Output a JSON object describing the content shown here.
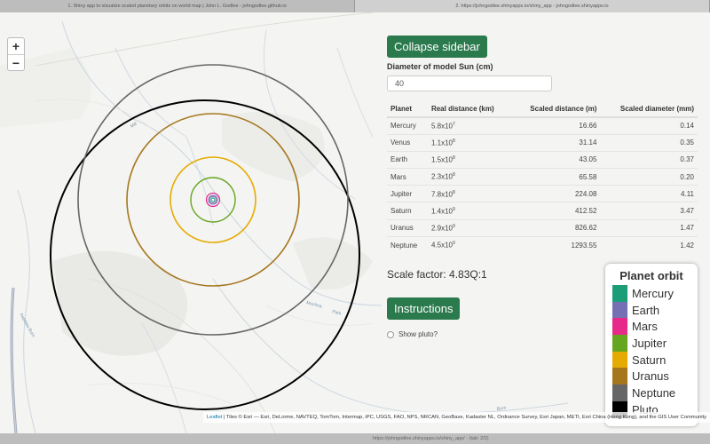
{
  "browser": {
    "tabs": [
      {
        "title": "1. Shiny app to visualize scaled planetary orbits on world map | John L. Godlee - johngodlee.github.io",
        "active": false
      },
      {
        "title": "2. https://johngodlee.shinyapps.io/shiny_app - johngodlee.shinyapps.io",
        "active": true
      }
    ],
    "status": "https://johngodlee.shinyapps.io/shiny_app/ - (tab: 2/2)"
  },
  "map": {
    "zoom_in": "+",
    "zoom_out": "−",
    "place_labels": [
      "Mill",
      "Burn",
      "Peebles",
      "Bantry",
      "Mochna",
      "Park",
      "Pebbles Burn"
    ],
    "attribution_link": "Leaflet",
    "attribution_text": " | Tiles © Esri — Esri, DeLorme, NAVTEQ, TomTom, Intermap, iPC, USGS, FAO, NPS, NRCAN, GeoBase, Kadaster NL, Ordnance Survey, Esri Japan, METI, Esri China (Hong Kong), and the GIS User Community"
  },
  "sidebar": {
    "collapse_label": "Collapse sidebar",
    "diameter_label": "Diameter of model Sun (cm)",
    "diameter_value": "40",
    "table": {
      "headers": [
        "Planet",
        "Real distance (km)",
        "Scaled distance (m)",
        "Scaled diameter (mm)"
      ],
      "rows": [
        {
          "planet": "Mercury",
          "mant": "5.8x10",
          "exp": "7",
          "dist": "16.66",
          "diam": "0.14"
        },
        {
          "planet": "Venus",
          "mant": "1.1x10",
          "exp": "8",
          "dist": "31.14",
          "diam": "0.35"
        },
        {
          "planet": "Earth",
          "mant": "1.5x10",
          "exp": "8",
          "dist": "43.05",
          "diam": "0.37"
        },
        {
          "planet": "Mars",
          "mant": "2.3x10",
          "exp": "8",
          "dist": "65.58",
          "diam": "0.20"
        },
        {
          "planet": "Jupiter",
          "mant": "7.8x10",
          "exp": "8",
          "dist": "224.08",
          "diam": "4.11"
        },
        {
          "planet": "Saturn",
          "mant": "1.4x10",
          "exp": "9",
          "dist": "412.52",
          "diam": "3.47"
        },
        {
          "planet": "Uranus",
          "mant": "2.9x10",
          "exp": "9",
          "dist": "826.62",
          "diam": "1.47"
        },
        {
          "planet": "Neptune",
          "mant": "4.5x10",
          "exp": "9",
          "dist": "1293.55",
          "diam": "1.42"
        }
      ]
    },
    "scale_factor": "Scale factor: 4.83Q:1",
    "instructions_label": "Instructions",
    "show_pluto_label": "Show pluto?"
  },
  "legend": {
    "title": "Planet orbit",
    "items": [
      {
        "name": "Mercury",
        "color": "#1b9e77"
      },
      {
        "name": "Earth",
        "color": "#7570b3"
      },
      {
        "name": "Mars",
        "color": "#e7298a"
      },
      {
        "name": "Jupiter",
        "color": "#66a61e"
      },
      {
        "name": "Saturn",
        "color": "#e6ab02"
      },
      {
        "name": "Uranus",
        "color": "#a6761d"
      },
      {
        "name": "Neptune",
        "color": "#666666"
      },
      {
        "name": "Pluto",
        "color": "#000000"
      }
    ]
  },
  "orbits": [
    {
      "planet": "Mercury",
      "color": "#1b9e77"
    },
    {
      "planet": "Venus",
      "color": "#7570b3"
    },
    {
      "planet": "Earth",
      "color": "#7570b3"
    },
    {
      "planet": "Mars",
      "color": "#e7298a"
    },
    {
      "planet": "Jupiter",
      "color": "#66a61e"
    },
    {
      "planet": "Saturn",
      "color": "#e6ab02"
    },
    {
      "planet": "Uranus",
      "color": "#a6761d"
    },
    {
      "planet": "Neptune",
      "color": "#666666"
    },
    {
      "planet": "Pluto",
      "color": "#000000"
    }
  ]
}
